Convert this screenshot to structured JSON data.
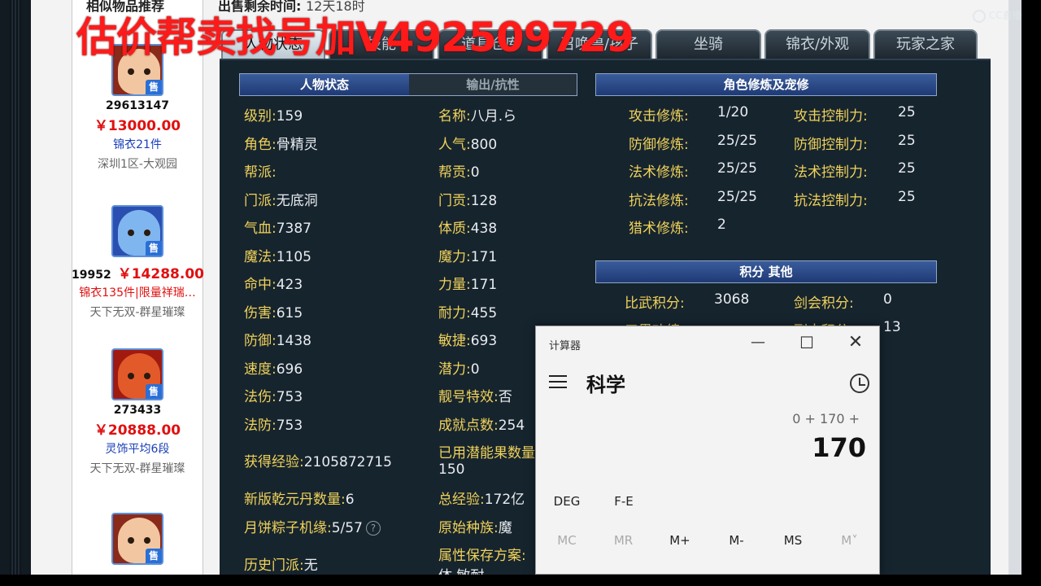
{
  "watermark": "估价帮卖找号加V492509729",
  "logo_text": "CC直播",
  "left_list": {
    "title": "相似物品推荐",
    "items": [
      {
        "id": "29613147",
        "price": "￥13000.00",
        "tag": "锦衣21件",
        "tag_color": "#1a3fb8",
        "server": "深圳1区-大观园",
        "avatar_colors": [
          "#f2c6a0",
          "#8a2a1a"
        ]
      },
      {
        "id": "19952",
        "price": "￥14288.00",
        "tag": "锦衣135件|限量祥瑞…",
        "tag_color": "#e01010",
        "server": "天下无双-群星璀璨",
        "avatar_colors": [
          "#7fb6f0",
          "#2b4fb0"
        ]
      },
      {
        "id": "273433",
        "price": "￥20888.00",
        "tag": "灵饰平均6段",
        "tag_color": "#1a3fb8",
        "server": "天下无双-群星璀璨",
        "avatar_colors": [
          "#e25a2a",
          "#a01a10"
        ]
      },
      {
        "id": "",
        "price": "",
        "tag": "",
        "tag_color": "#1a3fb8",
        "server": "",
        "avatar_colors": [
          "#f2c6a0",
          "#8a2a1a"
        ]
      }
    ]
  },
  "sale_time": {
    "label": "出售剩余时间:",
    "value": "12天18时"
  },
  "tabs": [
    "人物状态",
    "技能",
    "道具仓库",
    "召唤兽/孩子",
    "坐骑",
    "锦衣/外观",
    "玩家之家"
  ],
  "status_headers": {
    "active": "人物状态",
    "inactive": "输出/抗性"
  },
  "status_left": [
    {
      "label": "级别:",
      "value": "159"
    },
    {
      "label": "角色:",
      "value": "骨精灵"
    },
    {
      "label": "帮派:",
      "value": ""
    },
    {
      "label": "门派:",
      "value": "无底洞"
    },
    {
      "label": "气血:",
      "value": "7387"
    },
    {
      "label": "魔法:",
      "value": "1105"
    },
    {
      "label": "命中:",
      "value": "423"
    },
    {
      "label": "伤害:",
      "value": "615"
    },
    {
      "label": "防御:",
      "value": "1438"
    },
    {
      "label": "速度:",
      "value": "696"
    },
    {
      "label": "法伤:",
      "value": "753"
    },
    {
      "label": "法防:",
      "value": "753"
    }
  ],
  "status_right": [
    {
      "label": "名称:",
      "value": "八月.ら"
    },
    {
      "label": "人气:",
      "value": "800"
    },
    {
      "label": "帮贡:",
      "value": "0"
    },
    {
      "label": "门贡:",
      "value": "128"
    },
    {
      "label": "体质:",
      "value": "438"
    },
    {
      "label": "魔力:",
      "value": "171"
    },
    {
      "label": "力量:",
      "value": "171"
    },
    {
      "label": "耐力:",
      "value": "455"
    },
    {
      "label": "敏捷:",
      "value": "693"
    },
    {
      "label": "潜力:",
      "value": "0"
    },
    {
      "label": "靓号特效:",
      "value": "否"
    },
    {
      "label": "成就点数:",
      "value": "254"
    }
  ],
  "extra_left": [
    {
      "label": "获得经验:",
      "value": "2105872715"
    },
    {
      "label": "新版乾元丹数量:",
      "value": "6"
    },
    {
      "label": "月饼粽子机缘:",
      "value": "5/57"
    },
    {
      "label": "历史门派:",
      "value": "无"
    }
  ],
  "extra_right": [
    {
      "label": "已用潜能果数量",
      "value": "150"
    },
    {
      "label": "总经验:",
      "value": "172亿"
    },
    {
      "label": "原始种族:",
      "value": "魔"
    },
    {
      "label": "属性保存方案:",
      "value": "体 敏耐"
    }
  ],
  "cultivation_header": "角色修炼及宠修",
  "cultivation": [
    {
      "label": "攻击修炼:",
      "value": "1/20",
      "ctrl_label": "攻击控制力:",
      "ctrl_value": "25"
    },
    {
      "label": "防御修炼:",
      "value": "25/25",
      "ctrl_label": "防御控制力:",
      "ctrl_value": "25"
    },
    {
      "label": "法术修炼:",
      "value": "25/25",
      "ctrl_label": "法术控制力:",
      "ctrl_value": "25"
    },
    {
      "label": "抗法修炼:",
      "value": "25/25",
      "ctrl_label": "抗法控制力:",
      "ctrl_value": "25"
    },
    {
      "label": "猎术修炼:",
      "value": "2",
      "ctrl_label": "",
      "ctrl_value": ""
    }
  ],
  "points_header": "积分 其他",
  "points": [
    {
      "label": "比武积分:",
      "value": "3068",
      "label2": "剑会积分:",
      "value2": "0"
    },
    {
      "label": "三界功绩:",
      "value": "",
      "label2": "副本积分:",
      "value2": "13"
    }
  ],
  "calculator": {
    "title": "计算器",
    "mode": "科学",
    "expression": "0 + 170 +",
    "display": "170",
    "row1": [
      "DEG",
      "F-E"
    ],
    "row2": [
      "MC",
      "MR",
      "M+",
      "M-",
      "MS",
      "M˅"
    ]
  }
}
